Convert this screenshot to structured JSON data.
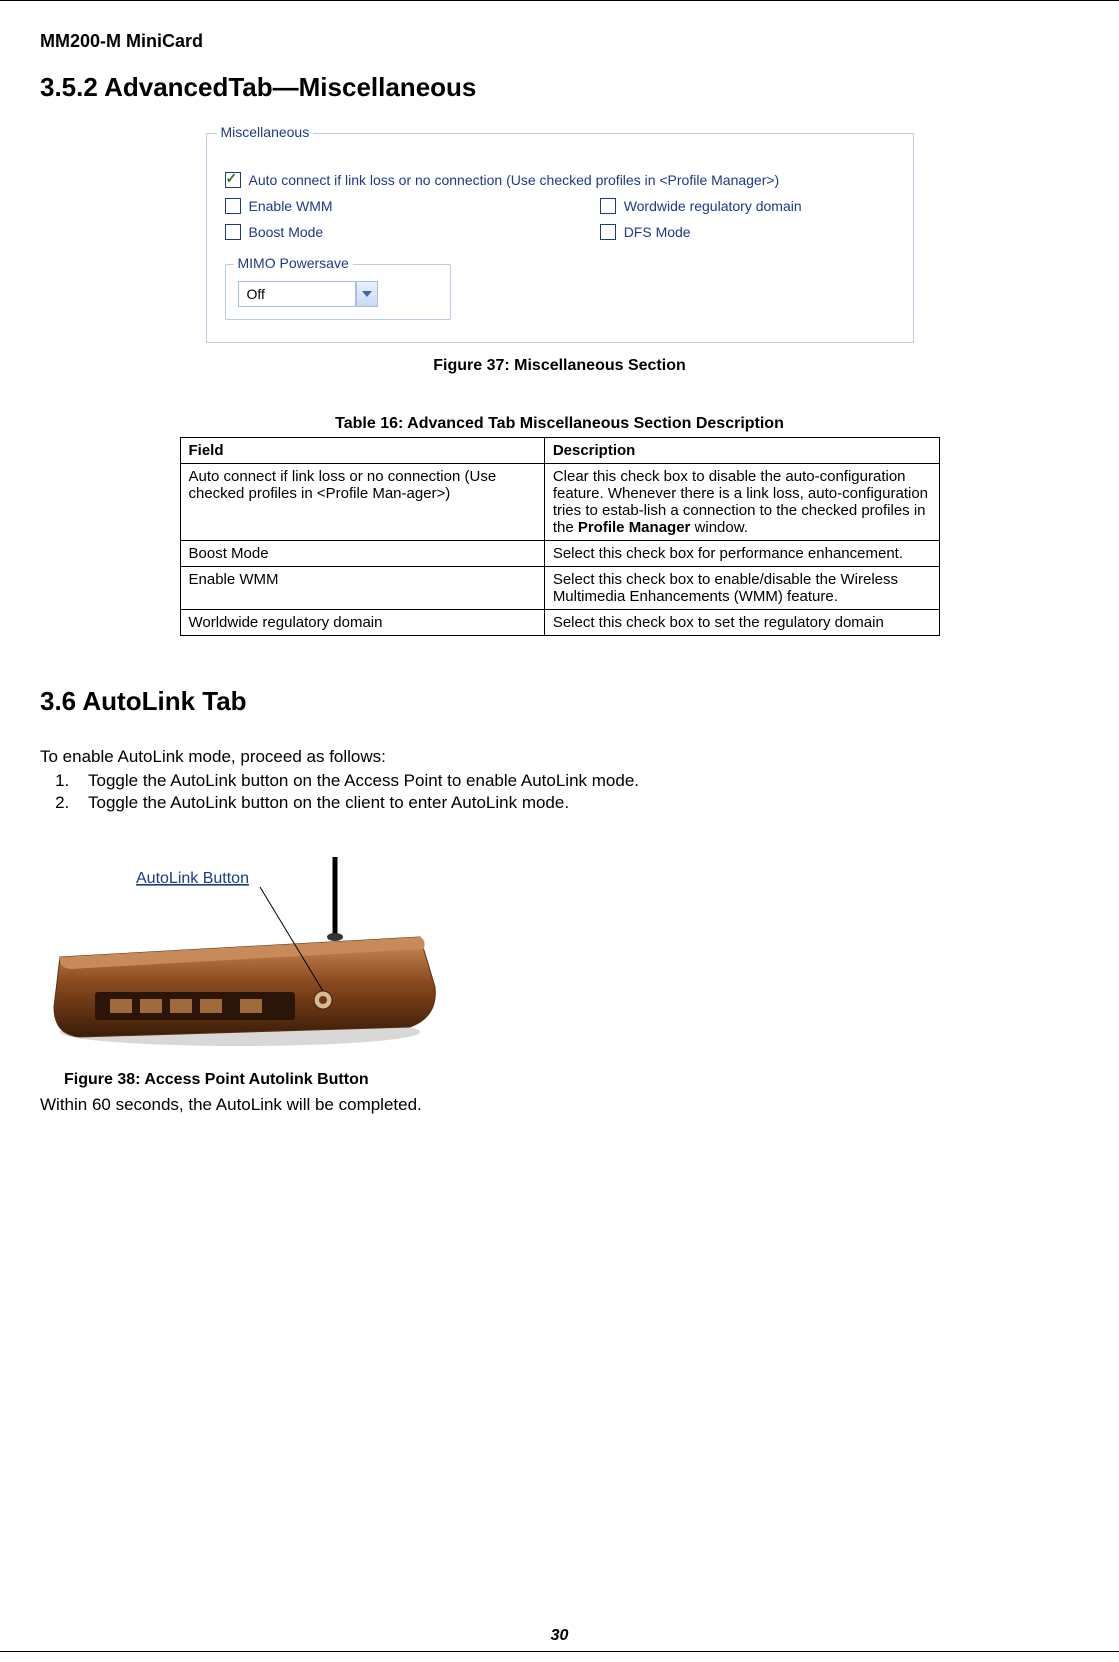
{
  "header": "MM200-M MiniCard",
  "section1_title": "3.5.2 AdvancedTab—Miscellaneous",
  "misc": {
    "legend": "Miscellaneous",
    "auto_connect": "Auto connect if link loss or no connection (Use checked profiles in <Profile Manager>)",
    "enable_wmm": "Enable WMM",
    "wordwide": "Wordwide regulatory domain",
    "boost": "Boost Mode",
    "dfs": "DFS Mode",
    "mimo_legend": "MIMO Powersave",
    "mimo_value": "Off"
  },
  "fig37": "Figure 37: Miscellaneous Section",
  "table_caption": "Table 16: Advanced Tab Miscellaneous Section Description",
  "th_field": "Field",
  "th_desc": "Description",
  "rows": [
    {
      "f": "Auto connect if link loss or no connection (Use checked profiles in <Profile Man-ager>)",
      "d": "Clear this check box to disable the auto-configuration feature. Whenever there is a link loss, auto-configuration tries to estab-lish a connection to the checked profiles in the Profile Manager window."
    },
    {
      "f": "Boost Mode",
      "d": "Select this check box for performance enhancement."
    },
    {
      "f": "Enable WMM",
      "d": "Select this check box to enable/disable the Wireless Multimedia Enhancements (WMM) feature."
    },
    {
      "f": "Worldwide regulatory domain",
      "d": "Select this check box to set the regulatory domain"
    }
  ],
  "section2_title": "3.6 AutoLink Tab",
  "intro": "To enable AutoLink mode, proceed as follows:",
  "steps": [
    "Toggle the AutoLink button on the Access Point to enable AutoLink mode.",
    "Toggle the AutoLink button on the client to enter AutoLink mode."
  ],
  "autolink_label": "AutoLink Button",
  "fig38": "Figure 38: Access Point Autolink Button",
  "closing": "Within 60 seconds, the AutoLink will be completed.",
  "page_no": "30"
}
